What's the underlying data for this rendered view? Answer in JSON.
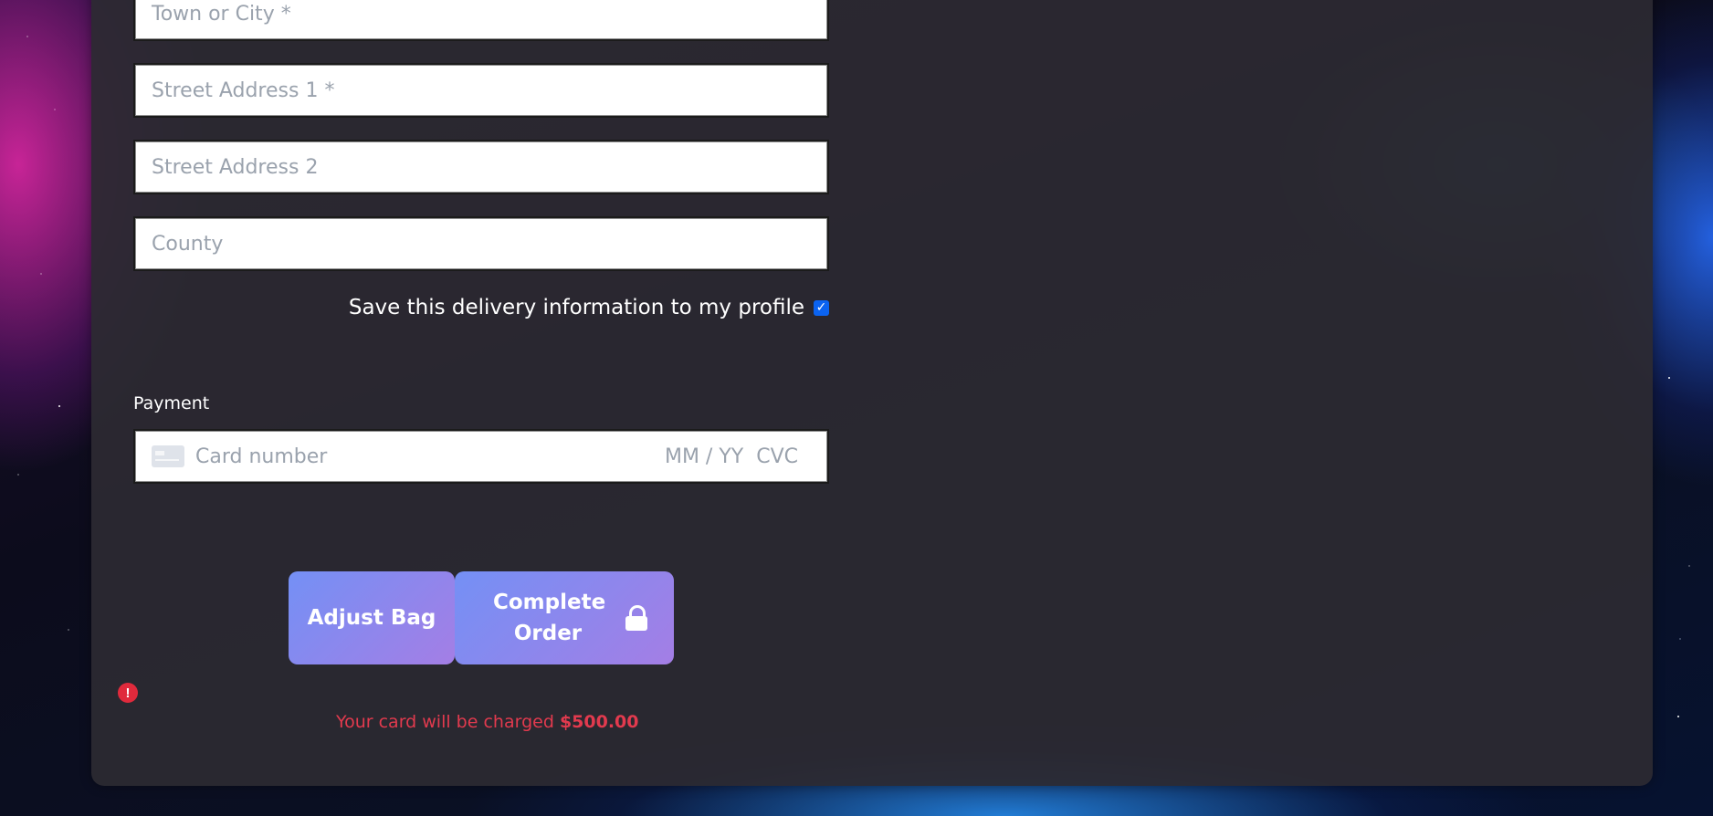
{
  "form": {
    "town_placeholder": "Town or City *",
    "street1_placeholder": "Street Address 1 *",
    "street2_placeholder": "Street Address 2",
    "county_placeholder": "County",
    "save_info_label": "Save this delivery information to my profile",
    "save_info_checked": true
  },
  "payment": {
    "label": "Payment",
    "card_number_placeholder": "Card number",
    "expiry_placeholder": "MM / YY",
    "cvc_placeholder": "CVC"
  },
  "actions": {
    "adjust_bag_label": "Adjust Bag",
    "complete_order_label": "Complete Order"
  },
  "charge": {
    "prefix": "Your card will be charged",
    "amount": "$500.00"
  },
  "colors": {
    "button_gradient_start": "#7490f5",
    "button_gradient_end": "#a47ee5",
    "error": "#e23a4e",
    "checkbox": "#0b63f0"
  },
  "icons": {
    "card": "credit-card-icon",
    "lock": "lock-icon",
    "error": "exclamation-circle-icon",
    "check": "checkmark-icon"
  }
}
